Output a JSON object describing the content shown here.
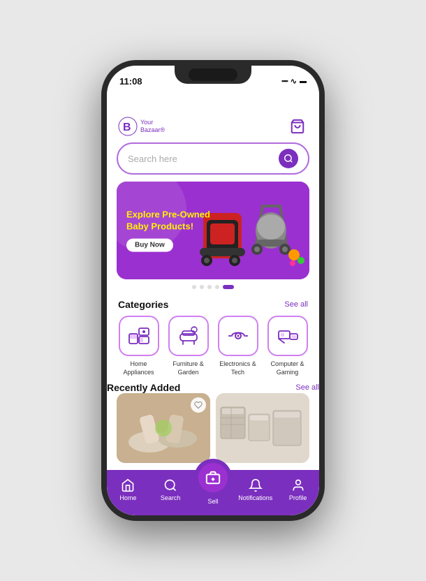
{
  "status_bar": {
    "time": "11:08",
    "signal": "●●●●",
    "wifi": "WiFi",
    "battery": "🔋"
  },
  "header": {
    "logo_name": "Your",
    "logo_sub": "Bazaar®",
    "cart_label": "cart"
  },
  "search": {
    "placeholder": "Search here"
  },
  "banner": {
    "title": "Explore Pre-Owned Baby Products!",
    "button_label": "Buy Now",
    "dots": [
      "dot",
      "dot",
      "dot",
      "dot",
      "dot-active"
    ]
  },
  "sections": {
    "categories_title": "Categories",
    "categories_see_all": "See all",
    "categories": [
      {
        "label": "Home Appliances",
        "icon": "🏠"
      },
      {
        "label": "Furniture & Garden",
        "icon": "🛋"
      },
      {
        "label": "Electronics & Tech",
        "icon": "🎧"
      },
      {
        "label": "Computer & Gaming",
        "icon": "💻"
      }
    ],
    "recently_title": "Recently Added",
    "recently_see_all": "See all",
    "recently_items": [
      {
        "type": "ballet",
        "has_heart": true
      },
      {
        "type": "storage",
        "has_heart": false
      }
    ]
  },
  "bottom_nav": {
    "items": [
      {
        "label": "Home",
        "icon": "home"
      },
      {
        "label": "Search",
        "icon": "search"
      },
      {
        "label": "Sell",
        "icon": "sell",
        "is_sell": true
      },
      {
        "label": "Notifications",
        "icon": "notifications"
      },
      {
        "label": "Profile",
        "icon": "profile"
      }
    ]
  }
}
